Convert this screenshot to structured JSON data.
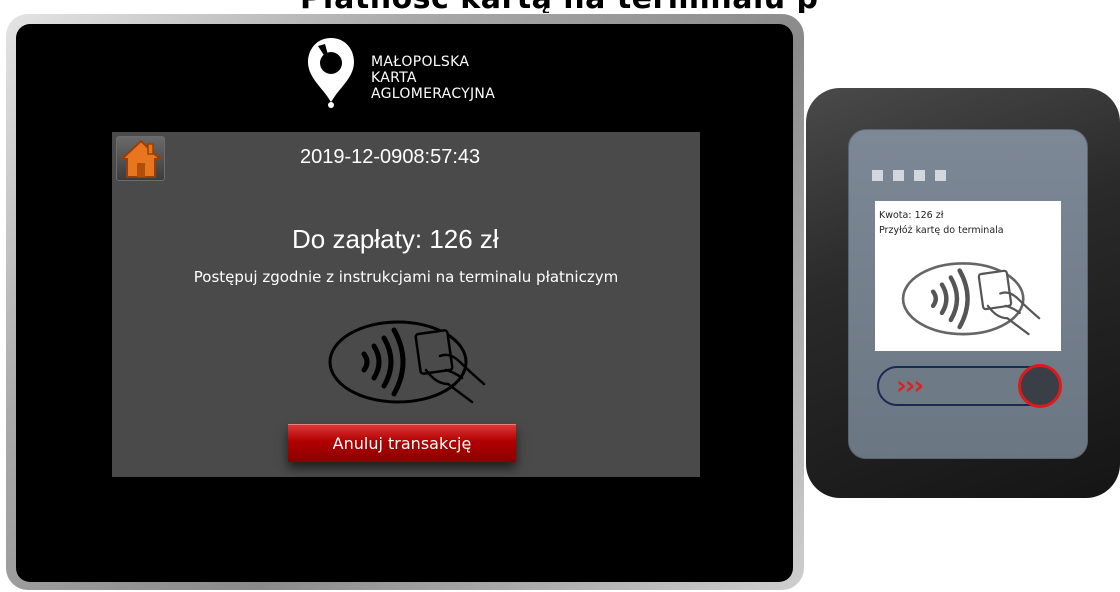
{
  "page": {
    "heading": "Płatność kartą na terminalu płatniczym"
  },
  "kiosk": {
    "logo": {
      "line1": "MAŁOPOLSKA",
      "line2": "KARTA",
      "line3": "AGLOMERACYJNA"
    },
    "home_icon": "home-icon",
    "date": "2019-12-09",
    "time": "08:57:43",
    "amount_label": "Do zapłaty:",
    "amount_value": "126 zł",
    "instruction": "Postępuj zgodnie z instrukcjami na terminalu płatniczym",
    "cancel_label": "Anuluj transakcję",
    "colors": {
      "panel": "#4a4a4a",
      "cancel_button": "#b10000",
      "screen": "#000000"
    }
  },
  "terminal": {
    "line1": "Kwota: 126 zł",
    "line2": "Przyłóż kartę do terminala",
    "slider_arrows": "›››",
    "colors": {
      "face": "#747f8c",
      "accent": "#e01818"
    }
  }
}
